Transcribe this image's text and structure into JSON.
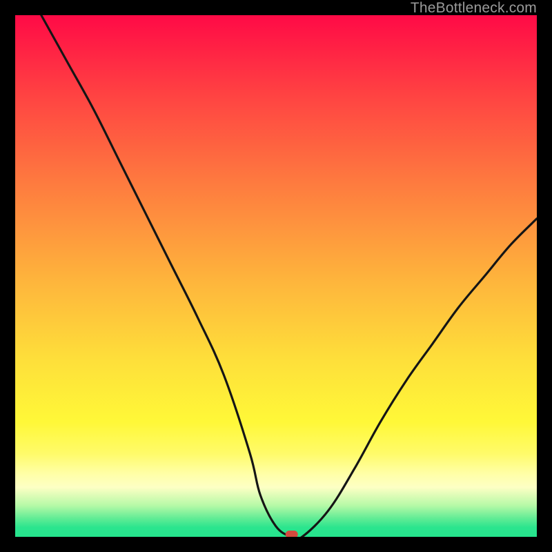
{
  "watermark": "TheBottleneck.com",
  "chart_data": {
    "type": "line",
    "title": "",
    "xlabel": "",
    "ylabel": "",
    "xlim": [
      0,
      100
    ],
    "ylim": [
      0,
      100
    ],
    "grid": false,
    "legend": false,
    "series": [
      {
        "name": "bottleneck-curve",
        "x": [
          5,
          10,
          15,
          20,
          25,
          30,
          35,
          40,
          45,
          47,
          50,
          53,
          55,
          60,
          65,
          70,
          75,
          80,
          85,
          90,
          95,
          100
        ],
        "y": [
          100,
          91,
          82,
          72,
          62,
          52,
          42,
          31,
          16,
          8,
          2,
          0,
          0,
          5,
          13,
          22,
          30,
          37,
          44,
          50,
          56,
          61
        ]
      }
    ],
    "annotations": [
      {
        "name": "optimal-marker",
        "x": 53,
        "y": 0,
        "color": "#d44a3e"
      }
    ],
    "background": {
      "type": "vertical-gradient",
      "stops": [
        {
          "pos": 0.0,
          "color": "#ff0a46"
        },
        {
          "pos": 0.5,
          "color": "#feb53c"
        },
        {
          "pos": 0.8,
          "color": "#fff838"
        },
        {
          "pos": 0.9,
          "color": "#fdffc4"
        },
        {
          "pos": 1.0,
          "color": "#26e48d"
        }
      ]
    }
  }
}
